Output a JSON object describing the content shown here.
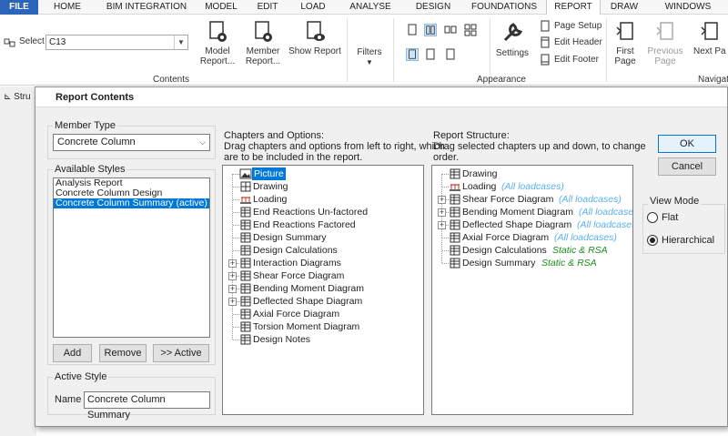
{
  "menu": {
    "tabs": [
      "FILE",
      "HOME",
      "BIM INTEGRATION",
      "MODEL",
      "EDIT",
      "LOAD",
      "ANALYSE",
      "DESIGN",
      "FOUNDATIONS",
      "REPORT",
      "DRAW",
      "WINDOWS"
    ],
    "active": "REPORT"
  },
  "ribbon": {
    "select_label": "Select",
    "select_value": "C13",
    "model_report": "Model Report...",
    "member_report": "Member Report...",
    "show_report": "Show Report",
    "contents_label": "Contents",
    "filters": "Filters",
    "settings": "Settings",
    "page_setup": "Page Setup",
    "edit_header": "Edit Header",
    "edit_footer": "Edit Footer",
    "appearance_label": "Appearance",
    "first_page": "First Page",
    "previous_page": "Previous Page",
    "next_page": "Next Pa",
    "navigation_label": "Navigat"
  },
  "background": {
    "str_tab": "Stru"
  },
  "dialog": {
    "title": "Report Contents",
    "member_type_label": "Member Type",
    "member_type_value": "Concrete Column",
    "available_styles_label": "Available Styles",
    "styles": [
      "Analysis Report",
      "Concrete Column Design",
      "Concrete Column Summary (active)"
    ],
    "selected_style_index": 2,
    "add_button": "Add",
    "remove_button": "Remove",
    "active_button": ">> Active",
    "active_style_label": "Active Style",
    "name_label": "Name",
    "name_value": "Concrete Column Summary",
    "chapters_title": "Chapters and Options:",
    "chapters_desc1": "Drag chapters and options from left to right, which",
    "chapters_desc2": "are to be included in the report.",
    "chapters": [
      {
        "label": "Picture",
        "expandable": false,
        "icon": "picture-icon",
        "selected": true
      },
      {
        "label": "Drawing",
        "expandable": false,
        "icon": "drawing-icon"
      },
      {
        "label": "Loading",
        "expandable": false,
        "icon": "loading-icon"
      },
      {
        "label": "End Reactions Un-factored",
        "expandable": false,
        "icon": "table-icon"
      },
      {
        "label": "End Reactions Factored",
        "expandable": false,
        "icon": "table-icon"
      },
      {
        "label": "Design Summary",
        "expandable": false,
        "icon": "table-icon"
      },
      {
        "label": "Design Calculations",
        "expandable": false,
        "icon": "table-icon"
      },
      {
        "label": "Interaction Diagrams",
        "expandable": true,
        "icon": "table-icon"
      },
      {
        "label": "Shear Force Diagram",
        "expandable": true,
        "icon": "table-icon"
      },
      {
        "label": "Bending Moment Diagram",
        "expandable": true,
        "icon": "table-icon"
      },
      {
        "label": "Deflected Shape Diagram",
        "expandable": true,
        "icon": "table-icon"
      },
      {
        "label": "Axial Force Diagram",
        "expandable": false,
        "icon": "table-icon"
      },
      {
        "label": "Torsion Moment Diagram",
        "expandable": false,
        "icon": "table-icon"
      },
      {
        "label": "Design Notes",
        "expandable": false,
        "icon": "table-icon"
      }
    ],
    "structure_title": "Report Structure:",
    "structure_desc1": "Drag selected chapters up and down, to change",
    "structure_desc2": "order.",
    "structure": [
      {
        "label": "Drawing",
        "expandable": false,
        "icon": "table-icon",
        "note": "",
        "note_color": ""
      },
      {
        "label": "Loading",
        "expandable": false,
        "icon": "loading-icon",
        "note": "(All loadcases)",
        "note_color": "blue"
      },
      {
        "label": "Shear Force Diagram",
        "expandable": true,
        "icon": "table-icon",
        "note": "(All loadcases)",
        "note_color": "blue"
      },
      {
        "label": "Bending Moment Diagram",
        "expandable": true,
        "icon": "table-icon",
        "note": "(All loadcases)",
        "note_color": "blue"
      },
      {
        "label": "Deflected Shape Diagram",
        "expandable": true,
        "icon": "table-icon",
        "note": "(All loadcases)",
        "note_color": "blue"
      },
      {
        "label": "Axial Force Diagram",
        "expandable": false,
        "icon": "table-icon",
        "note": "(All loadcases)",
        "note_color": "blue"
      },
      {
        "label": "Design Calculations",
        "expandable": false,
        "icon": "table-icon",
        "note": "Static & RSA",
        "note_color": "green"
      },
      {
        "label": "Design Summary",
        "expandable": false,
        "icon": "table-icon",
        "note": "Static & RSA",
        "note_color": "green"
      }
    ],
    "ok_button": "OK",
    "cancel_button": "Cancel",
    "view_mode_label": "View Mode",
    "view_flat": "Flat",
    "view_hierarchical": "Hierarchical",
    "view_selected": "Hierarchical"
  },
  "colors": {
    "accent": "#0078d7",
    "file_tab": "#2b64b8",
    "note_blue": "#5ab0ea",
    "note_green": "#1e8f1e"
  }
}
